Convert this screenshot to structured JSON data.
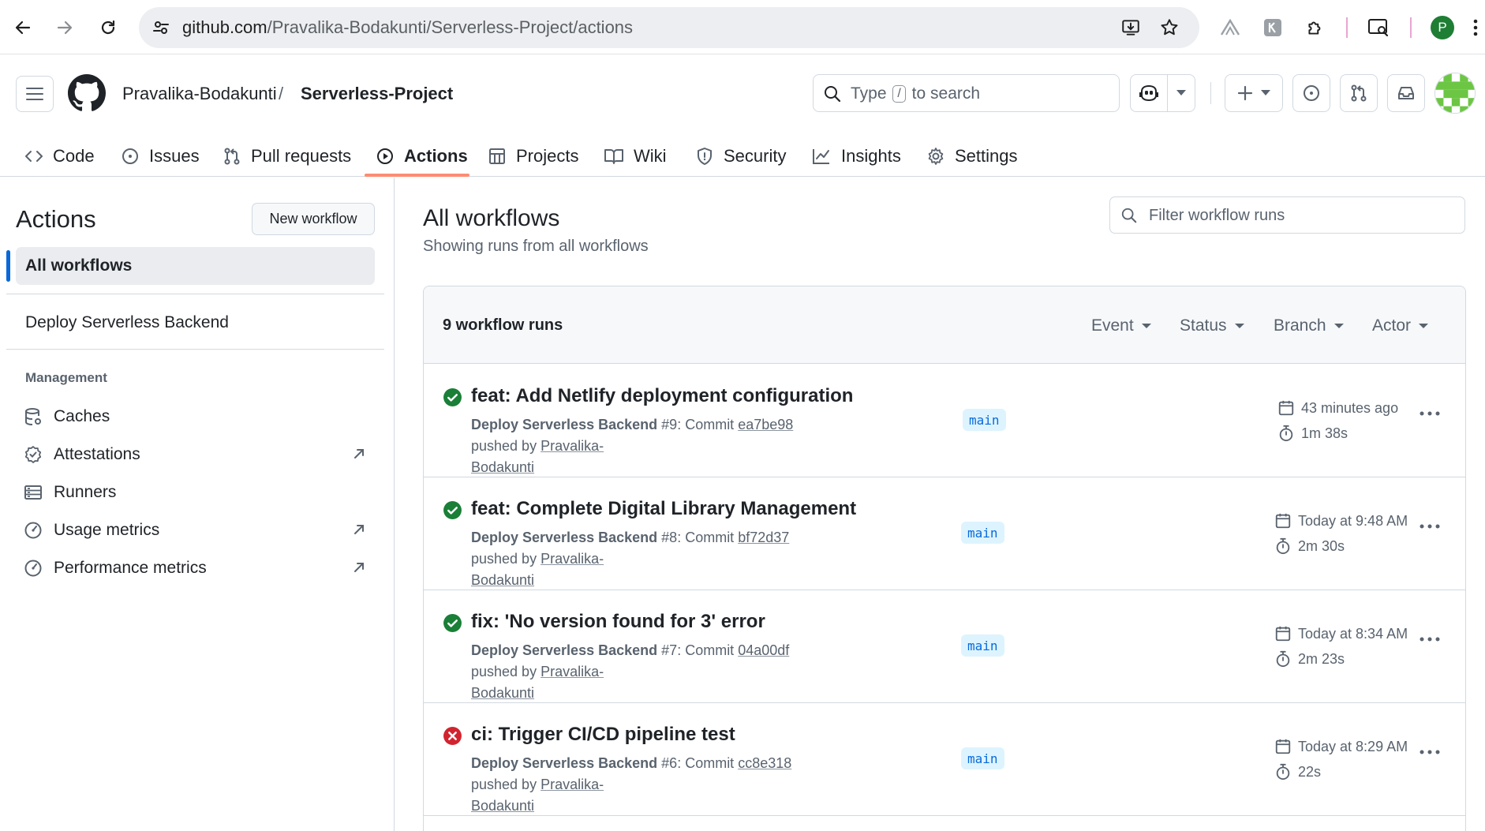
{
  "browser": {
    "url_host": "github.com",
    "url_path": "/Pravalika-Bodakunti/Serverless-Project/actions",
    "profile_initial": "P"
  },
  "header": {
    "owner": "Pravalika-Bodakunti",
    "separator": "/",
    "repo": "Serverless-Project",
    "search_prefix": "Type",
    "search_key": "/",
    "search_suffix": "to search"
  },
  "tabs": [
    {
      "label": "Code",
      "icon": "code-icon"
    },
    {
      "label": "Issues",
      "icon": "issue-icon"
    },
    {
      "label": "Pull requests",
      "icon": "pull-request-icon"
    },
    {
      "label": "Actions",
      "icon": "play-icon",
      "active": true
    },
    {
      "label": "Projects",
      "icon": "table-icon"
    },
    {
      "label": "Wiki",
      "icon": "book-icon"
    },
    {
      "label": "Security",
      "icon": "shield-icon"
    },
    {
      "label": "Insights",
      "icon": "graph-icon"
    },
    {
      "label": "Settings",
      "icon": "gear-icon"
    }
  ],
  "sidebar": {
    "title": "Actions",
    "new_workflow": "New workflow",
    "all_workflows": "All workflows",
    "workflow": "Deploy Serverless Backend",
    "management_label": "Management",
    "management": [
      {
        "label": "Caches",
        "icon": "database-icon",
        "external": false
      },
      {
        "label": "Attestations",
        "icon": "verified-icon",
        "external": true
      },
      {
        "label": "Runners",
        "icon": "server-icon",
        "external": false
      },
      {
        "label": "Usage metrics",
        "icon": "meter-icon",
        "external": true
      },
      {
        "label": "Performance metrics",
        "icon": "meter-icon",
        "external": true
      }
    ]
  },
  "main": {
    "title": "All workflows",
    "subtitle": "Showing runs from all workflows",
    "filter_placeholder": "Filter workflow runs",
    "runs_count": "9 workflow runs",
    "filters": [
      "Event",
      "Status",
      "Branch",
      "Actor"
    ],
    "runs": [
      {
        "status": "success",
        "title": "feat: Add Netlify deployment configuration",
        "workflow": "Deploy Serverless Backend",
        "run_no": "#9",
        "commit_label": ": Commit",
        "commit": "ea7be98",
        "pushed_by": "pushed by",
        "user_part1": "Pravalika-",
        "user_part2": "Bodakunti",
        "branch": "main",
        "when": "43 minutes ago",
        "duration": "1m 38s"
      },
      {
        "status": "success",
        "title": "feat: Complete Digital Library Management",
        "workflow": "Deploy Serverless Backend",
        "run_no": "#8",
        "commit_label": ": Commit",
        "commit": "bf72d37",
        "pushed_by": "pushed by",
        "user_part1": "Pravalika-",
        "user_part2": "Bodakunti",
        "branch": "main",
        "when": "Today at 9:48 AM",
        "duration": "2m 30s"
      },
      {
        "status": "success",
        "title": "fix: 'No version found for 3' error",
        "workflow": "Deploy Serverless Backend",
        "run_no": "#7",
        "commit_label": ": Commit",
        "commit": "04a00df",
        "pushed_by": "pushed by",
        "user_part1": "Pravalika-",
        "user_part2": "Bodakunti",
        "branch": "main",
        "when": "Today at 8:34 AM",
        "duration": "2m 23s"
      },
      {
        "status": "failure",
        "title": "ci: Trigger CI/CD pipeline test",
        "workflow": "Deploy Serverless Backend",
        "run_no": "#6",
        "commit_label": ": Commit",
        "commit": "cc8e318",
        "pushed_by": "pushed by",
        "user_part1": "Pravalika-",
        "user_part2": "Bodakunti",
        "branch": "main",
        "when": "Today at 8:29 AM",
        "duration": "22s"
      }
    ]
  },
  "colors": {
    "success": "#1a7f37",
    "failure": "#d1242f",
    "accent": "#0969da",
    "tab_underline": "#fd8c73"
  }
}
